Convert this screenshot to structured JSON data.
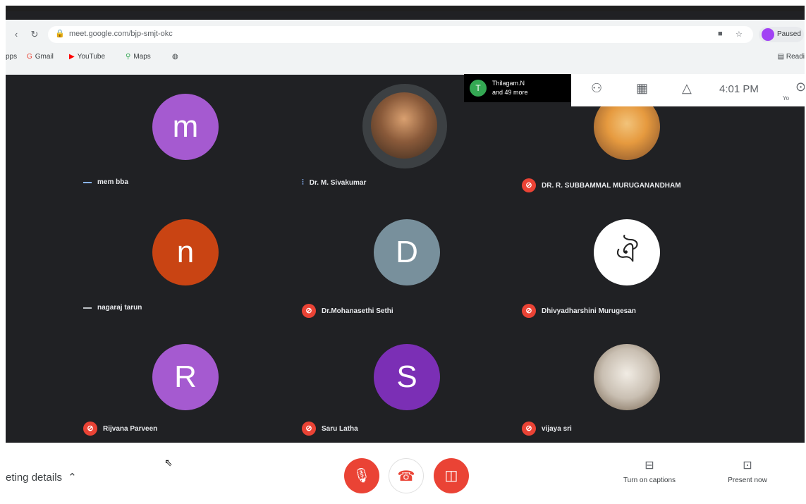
{
  "browser": {
    "url": "meet.google.com/bjp-smjt-okc",
    "profile_label": "Paused",
    "bookmarks": [
      {
        "label": "pps",
        "icon": "apps-icon"
      },
      {
        "label": "Gmail",
        "icon": "gmail-icon"
      },
      {
        "label": "YouTube",
        "icon": "youtube-icon"
      },
      {
        "label": "Maps",
        "icon": "maps-icon"
      }
    ],
    "reading_list": "Readi"
  },
  "people_chip": {
    "initial": "T",
    "line1": "Thilagam.N",
    "line2": "and 49 more"
  },
  "top_toolbar": {
    "time": "4:01 PM",
    "more_label": "Yo"
  },
  "participants": [
    {
      "name": "mem bba",
      "initial": "m",
      "color": "#a55ad0",
      "status": "speaking-off"
    },
    {
      "name": "Dr. M. Sivakumar",
      "initial": "",
      "color": "",
      "status": "speaking"
    },
    {
      "name": "DR. R. SUBBAMMAL MURUGANANDHAM",
      "initial": "",
      "color": "",
      "status": "muted"
    },
    {
      "name": "nagaraj tarun",
      "initial": "n",
      "color": "#c94413",
      "status": "speaking-off"
    },
    {
      "name": "Dr.Mohanasethi Sethi",
      "initial": "D",
      "color": "#78909c",
      "status": "muted"
    },
    {
      "name": "Dhivyadharshini Murugesan",
      "initial": "",
      "color": "",
      "status": "muted"
    },
    {
      "name": "Rijvana Parveen",
      "initial": "R",
      "color": "#a55ad0",
      "status": "muted"
    },
    {
      "name": "Saru Latha",
      "initial": "S",
      "color": "#7b2fb5",
      "status": "muted"
    },
    {
      "name": "vijaya sri",
      "initial": "",
      "color": "",
      "status": "muted"
    }
  ],
  "bottom": {
    "meeting_details": "eting details",
    "captions_label": "Turn on captions",
    "present_label": "Present now"
  },
  "colors": {
    "meet_bg": "#202124",
    "danger": "#ea4335",
    "speaking": "#8ab4f8"
  }
}
